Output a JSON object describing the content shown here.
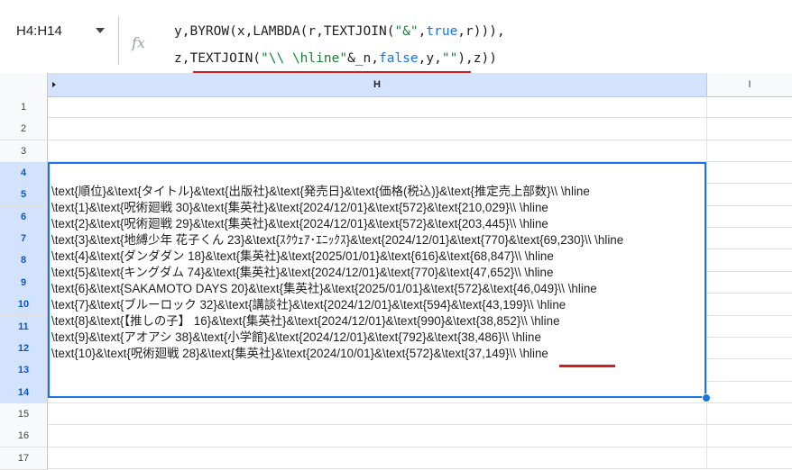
{
  "name_box": {
    "ref": "H4:H14"
  },
  "formula": {
    "fx_label": "fx",
    "line1": {
      "a": "y,BYROW(x,LAMBDA(r,TEXTJOIN(",
      "b": "\"&\"",
      "c": ",",
      "d": "true",
      "e": ",r))),"
    },
    "line2": {
      "a": "z,TEXTJOIN(",
      "b": "\"\\\\ \\hline\"",
      "c": "&_n,",
      "d": "false",
      "e": ",y,",
      "f": "\"\"",
      "g": "),z))"
    }
  },
  "columns": {
    "h": "H",
    "i": "I"
  },
  "rows": [
    "1",
    "2",
    "3",
    "4",
    "5",
    "6",
    "7",
    "8",
    "9",
    "10",
    "11",
    "12",
    "13",
    "14",
    "15",
    "16",
    "17"
  ],
  "selected_rows": [
    "4",
    "5",
    "6",
    "7",
    "8",
    "9",
    "10",
    "11",
    "12",
    "13",
    "14"
  ],
  "cell_output": [
    "\\text{順位}&\\text{タイトル}&\\text{出版社}&\\text{発売日}&\\text{価格(税込)}&\\text{推定売上部数}\\\\ \\hline",
    "\\text{1}&\\text{呪術廻戦 30}&\\text{集英社}&\\text{2024/12/01}&\\text{572}&\\text{210,029}\\\\ \\hline",
    "\\text{2}&\\text{呪術廻戦 29}&\\text{集英社}&\\text{2024/12/01}&\\text{572}&\\text{203,445}\\\\ \\hline",
    "\\text{3}&\\text{地縛少年 花子くん 23}&\\text{ｽｸｳｪｱ･ｴﾆｯｸｽ}&\\text{2024/12/01}&\\text{770}&\\text{69,230}\\\\ \\hline",
    "\\text{4}&\\text{ダンダダン 18}&\\text{集英社}&\\text{2025/01/01}&\\text{616}&\\text{68,847}\\\\ \\hline",
    "\\text{5}&\\text{キングダム 74}&\\text{集英社}&\\text{2024/12/01}&\\text{770}&\\text{47,652}\\\\ \\hline",
    "\\text{6}&\\text{SAKAMOTO DAYS 20}&\\text{集英社}&\\text{2025/01/01}&\\text{572}&\\text{46,049}\\\\ \\hline",
    "\\text{7}&\\text{ブルーロック 32}&\\text{講談社}&\\text{2024/12/01}&\\text{594}&\\text{43,199}\\\\ \\hline",
    "\\text{8}&\\text{【推しの子】 16}&\\text{集英社}&\\text{2024/12/01}&\\text{990}&\\text{38,852}\\\\ \\hline",
    "\\text{9}&\\text{アオアシ 38}&\\text{小学館}&\\text{2024/12/01}&\\text{792}&\\text{38,486}\\\\ \\hline",
    "\\text{10}&\\text{呪術廻戦 28}&\\text{集英社}&\\text{2024/10/01}&\\text{572}&\\text{37,149}\\\\ \\hline"
  ],
  "colors": {
    "accent": "#1a73e8",
    "highlight_underline": "#d01f1f",
    "header_selected": "#d3e3fd"
  }
}
